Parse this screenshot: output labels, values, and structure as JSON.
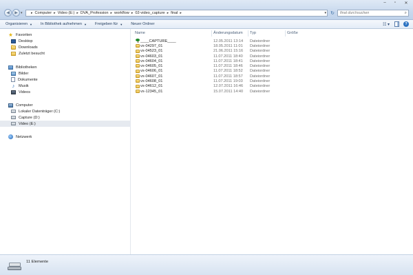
{
  "address": {
    "crumbs": [
      "Computer",
      "Video (E:)",
      "DVA_Profession",
      "workflow",
      "02-video_capture",
      "final"
    ]
  },
  "search": {
    "placeholder": "final durchsuchen"
  },
  "toolbar": {
    "organize": "Organisieren",
    "include_library": "In Bibliothek aufnehmen",
    "share": "Freigeben für",
    "new_folder": "Neuer Ordner"
  },
  "nav": {
    "favorites": {
      "label": "Favoriten",
      "items": [
        "Desktop",
        "Downloads",
        "Zuletzt besucht"
      ]
    },
    "libraries": {
      "label": "Bibliotheken",
      "items": [
        "Bilder",
        "Dokumente",
        "Musik",
        "Videos"
      ]
    },
    "computer": {
      "label": "Computer",
      "items": [
        "Lokaler Datenträger (C:)",
        "Capture (D:)",
        "Video (E:)"
      ],
      "selected": "Video (E:)"
    },
    "network": {
      "label": "Netzwerk"
    }
  },
  "columns": {
    "name": "Name",
    "date": "Änderungsdatum",
    "type": "Typ",
    "size": "Größe"
  },
  "files": [
    {
      "name": "____CAPTURE____",
      "date": "12.05.2011 13:14",
      "type": "Dateiordner",
      "icon": "tree-icon"
    },
    {
      "name": "vx-04297_01",
      "date": "18.05.2011 11:01",
      "type": "Dateiordner",
      "icon": "folder-icon"
    },
    {
      "name": "vx-04523_01",
      "date": "21.06.2011 15:16",
      "type": "Dateiordner",
      "icon": "folder-icon"
    },
    {
      "name": "vx-04603_01",
      "date": "11.07.2011 18:40",
      "type": "Dateiordner",
      "icon": "folder-icon"
    },
    {
      "name": "vx-04604_01",
      "date": "11.07.2011 18:41",
      "type": "Dateiordner",
      "icon": "folder-icon"
    },
    {
      "name": "vx-04605_01",
      "date": "11.07.2011 18:46",
      "type": "Dateiordner",
      "icon": "folder-icon"
    },
    {
      "name": "vx-04606_01",
      "date": "11.07.2011 18:52",
      "type": "Dateiordner",
      "icon": "folder-icon"
    },
    {
      "name": "vx-04607_01",
      "date": "11.07.2011 18:57",
      "type": "Dateiordner",
      "icon": "folder-icon"
    },
    {
      "name": "vx-04608_01",
      "date": "11.07.2011 19:03",
      "type": "Dateiordner",
      "icon": "folder-icon"
    },
    {
      "name": "vx-04612_01",
      "date": "12.07.2011 16:46",
      "type": "Dateiordner",
      "icon": "folder-icon"
    },
    {
      "name": "vx-12345_01",
      "date": "15.07.2011 14:40",
      "type": "Dateiordner",
      "icon": "folder-icon"
    }
  ],
  "status": {
    "count": "11 Elemente"
  }
}
